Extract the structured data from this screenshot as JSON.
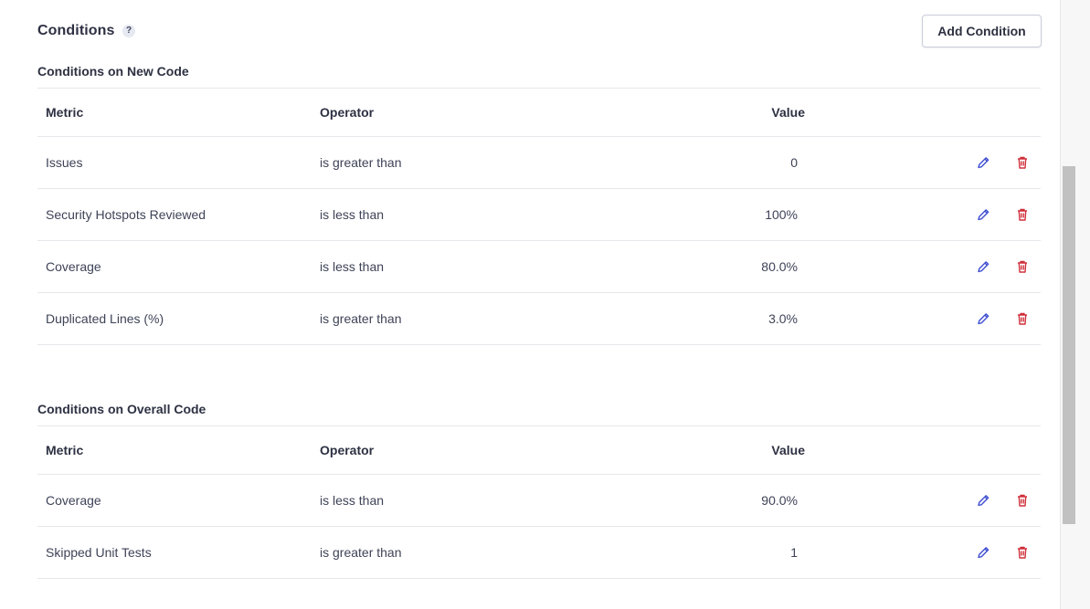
{
  "header": {
    "title": "Conditions",
    "help_symbol": "?",
    "add_button_label": "Add Condition"
  },
  "colors": {
    "edit_icon": "#3e4ed1",
    "delete_icon": "#d02f3a",
    "scroll_thumb": "#c1c1c1"
  },
  "new_code": {
    "title": "Conditions on New Code",
    "columns": {
      "metric": "Metric",
      "operator": "Operator",
      "value": "Value"
    },
    "rows": [
      {
        "metric": "Issues",
        "operator": "is greater than",
        "value": "0"
      },
      {
        "metric": "Security Hotspots Reviewed",
        "operator": "is less than",
        "value": "100%"
      },
      {
        "metric": "Coverage",
        "operator": "is less than",
        "value": "80.0%"
      },
      {
        "metric": "Duplicated Lines (%)",
        "operator": "is greater than",
        "value": "3.0%"
      }
    ]
  },
  "overall_code": {
    "title": "Conditions on Overall Code",
    "columns": {
      "metric": "Metric",
      "operator": "Operator",
      "value": "Value"
    },
    "rows": [
      {
        "metric": "Coverage",
        "operator": "is less than",
        "value": "90.0%"
      },
      {
        "metric": "Skipped Unit Tests",
        "operator": "is greater than",
        "value": "1"
      }
    ]
  },
  "icons": {
    "edit": "pencil-icon",
    "delete": "trash-icon",
    "help": "question-icon"
  }
}
